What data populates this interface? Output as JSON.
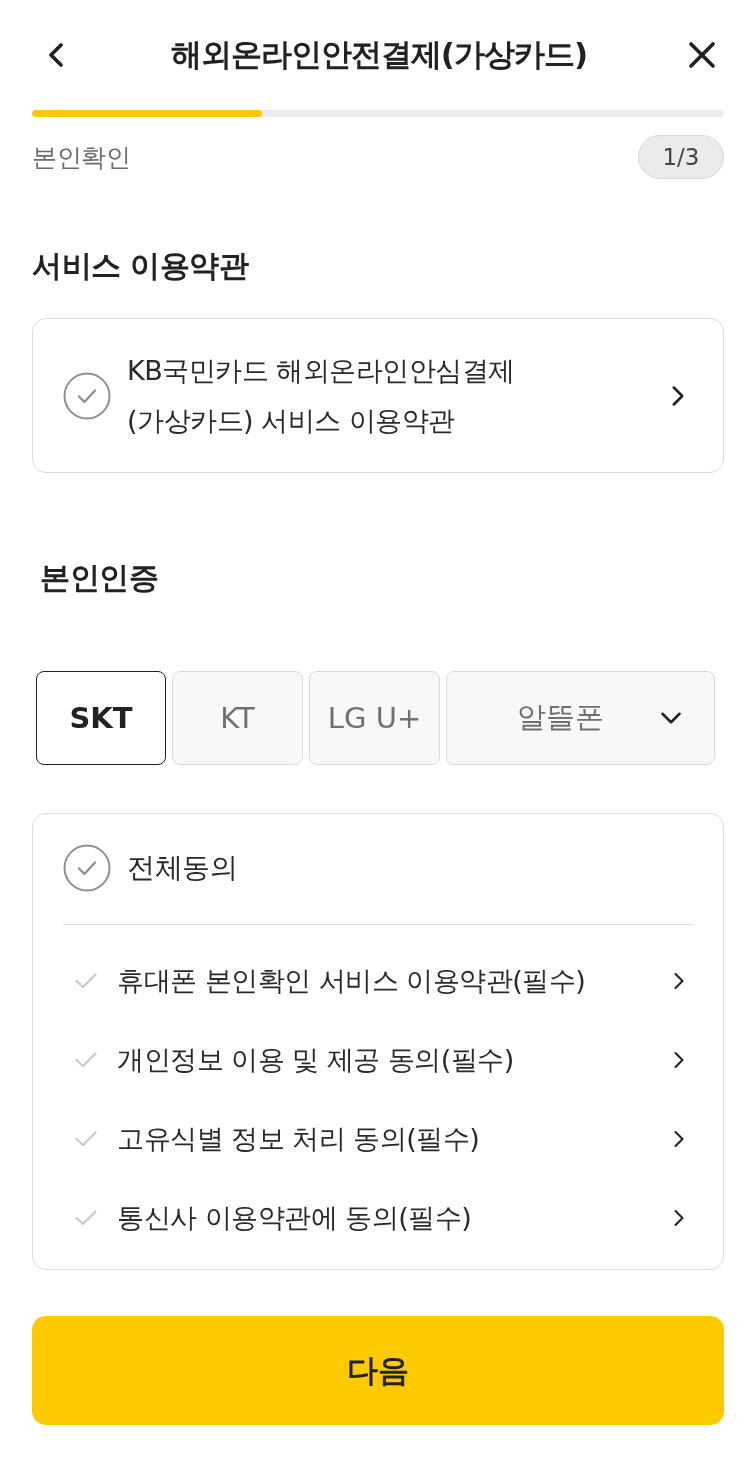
{
  "header": {
    "title": "해외온라인안전결제(가상카드)"
  },
  "progress": {
    "level": 0.333,
    "step_label": "본인확인",
    "step_count": "1/3"
  },
  "terms_section": {
    "heading": "서비스 이용약관",
    "items": [
      {
        "label": "KB국민카드 해외온라인안심결제 (가상카드) 서비스 이용약관",
        "checked": false
      }
    ]
  },
  "verification_section": {
    "heading": "본인인증"
  },
  "carriers": [
    {
      "label": "SKT",
      "selected": true,
      "kind": "tab"
    },
    {
      "label": "KT",
      "selected": false,
      "kind": "tab"
    },
    {
      "label": "LG U+",
      "selected": false,
      "kind": "tab"
    },
    {
      "label": "알뜰폰",
      "selected": false,
      "kind": "dropdown"
    }
  ],
  "agreement": {
    "agree_all": {
      "label": "전체동의",
      "checked": false
    },
    "items": [
      {
        "label": "휴대폰 본인확인 서비스 이용약관(필수)",
        "checked": false
      },
      {
        "label": "개인정보 이용 및 제공 동의(필수)",
        "checked": false
      },
      {
        "label": "고유식별 정보 처리 동의(필수)",
        "checked": false
      },
      {
        "label": "통신사 이용약관에 동의(필수)",
        "checked": false
      }
    ]
  },
  "next_button": {
    "label": "다음"
  }
}
